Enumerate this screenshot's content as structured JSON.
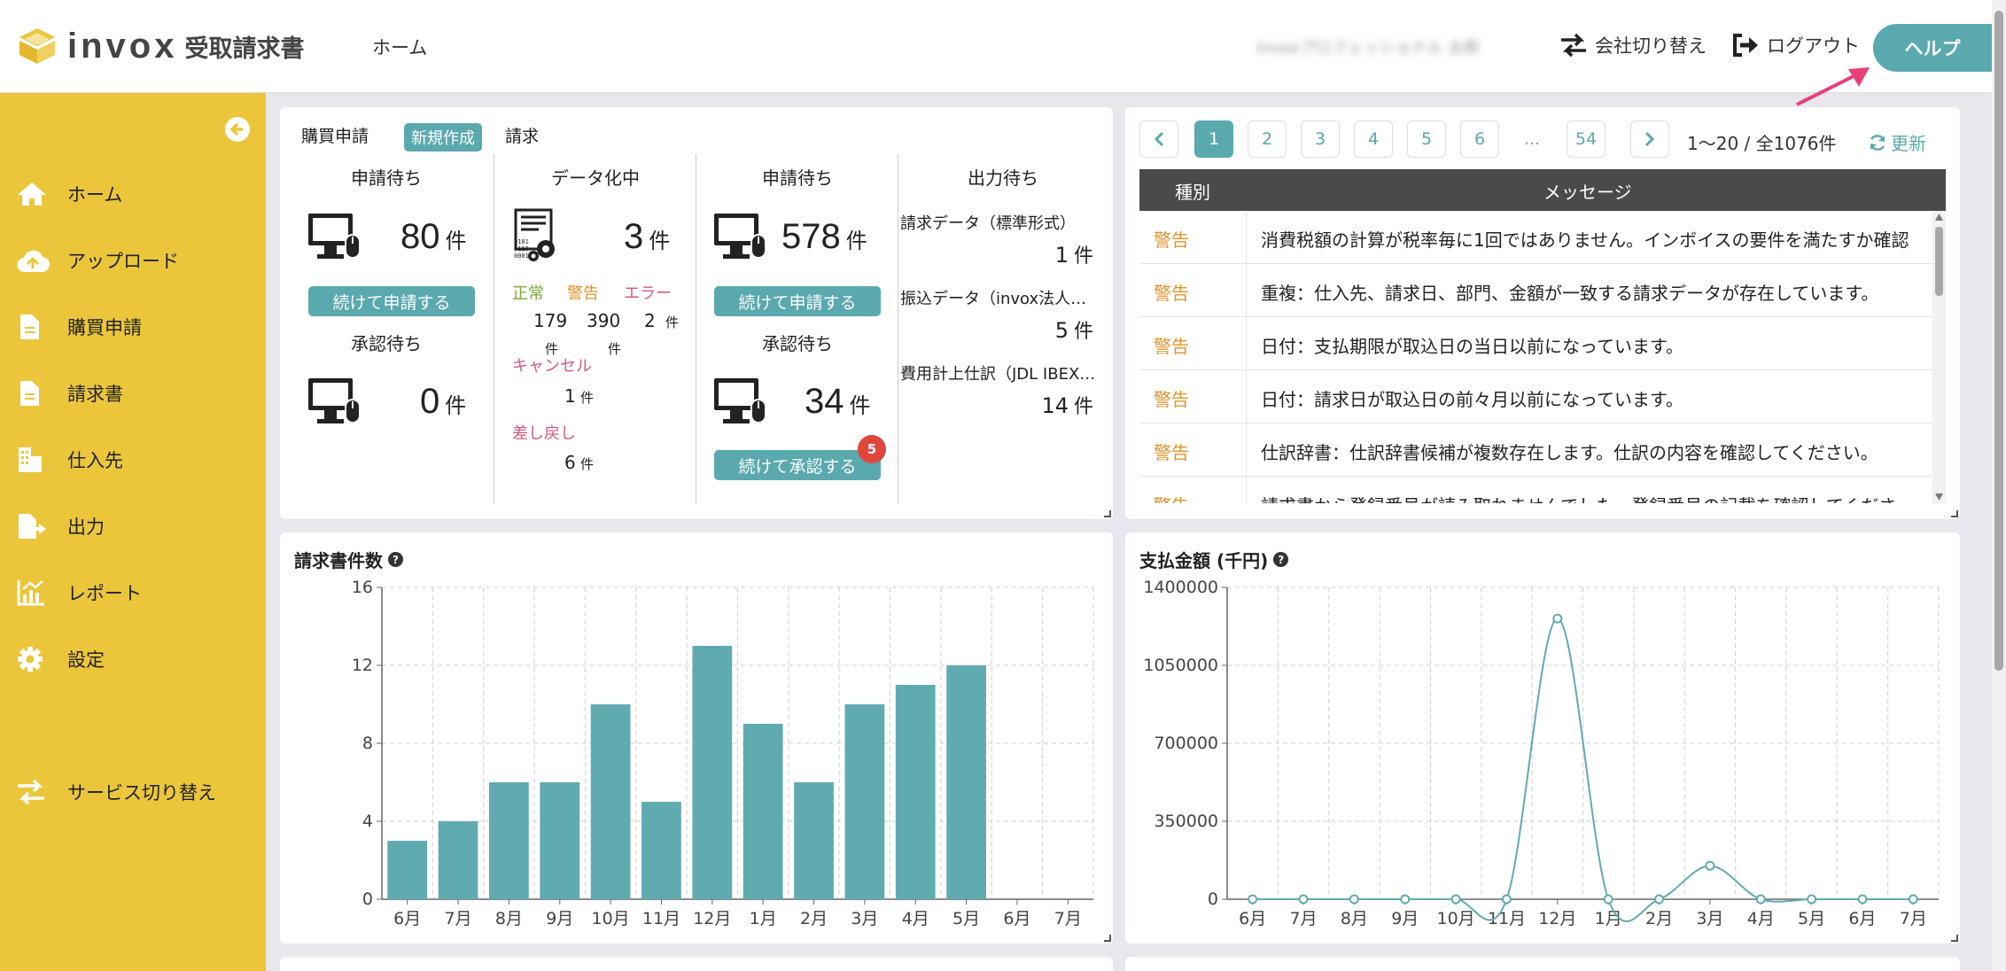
{
  "header": {
    "logo_word": "invox",
    "logo_sub": "受取請求書",
    "nav_home": "ホーム",
    "user_name": "invoxプロフェッショナル 太郎",
    "switch_company": "会社切り替え",
    "logout": "ログアウト",
    "help": "ヘルプ"
  },
  "sidebar": {
    "items": [
      {
        "label": "ホーム",
        "icon": "home-icon"
      },
      {
        "label": "アップロード",
        "icon": "cloud-upload-icon"
      },
      {
        "label": "購買申請",
        "icon": "document-icon"
      },
      {
        "label": "請求書",
        "icon": "document-icon"
      },
      {
        "label": "仕入先",
        "icon": "building-icon"
      },
      {
        "label": "出力",
        "icon": "file-export-icon"
      },
      {
        "label": "レポート",
        "icon": "chart-icon"
      },
      {
        "label": "設定",
        "icon": "gear-icon"
      }
    ],
    "service_switch": "サービス切り替え"
  },
  "summary": {
    "purchase_title": "購買申請",
    "new_button": "新規作成",
    "invoice_title": "請求",
    "purchase": {
      "pending_apply_label": "申請待ち",
      "pending_apply_count": "80",
      "continue_apply": "続けて申請する",
      "pending_approve_label": "承認待ち",
      "pending_approve_count": "0"
    },
    "digitizing": {
      "label": "データ化中",
      "count": "3",
      "normal_label": "正常",
      "warning_label": "警告",
      "error_label": "エラー",
      "normal_count": "179",
      "warning_count": "390",
      "error_count": "2",
      "cancel_label": "キャンセル",
      "cancel_count": "1",
      "returned_label": "差し戻し",
      "returned_count": "6"
    },
    "invoice": {
      "pending_apply_label": "申請待ち",
      "pending_apply_count": "578",
      "continue_apply": "続けて申請する",
      "pending_approve_label": "承認待ち",
      "pending_approve_count": "34",
      "continue_approve": "続けて承認する",
      "approve_badge": "5"
    },
    "output": {
      "label": "出力待ち",
      "items": [
        {
          "label": "請求データ（標準形式）",
          "count": "1"
        },
        {
          "label": "振込データ（invox法人…",
          "count": "5"
        },
        {
          "label": "費用計上仕訳（JDL IBEX…",
          "count": "14"
        }
      ]
    },
    "unit": "件"
  },
  "messages": {
    "pages": [
      "1",
      "2",
      "3",
      "4",
      "5",
      "6",
      "…",
      "54"
    ],
    "active_page": "1",
    "range_info": "1〜20 / 全1076件",
    "refresh": "更新",
    "col_kind": "種別",
    "col_message": "メッセージ",
    "rows": [
      {
        "kind": "警告",
        "message": "消費税額の計算が税率毎に1回ではありません。インボイスの要件を満たすか確認"
      },
      {
        "kind": "警告",
        "message": "重複：仕入先、請求日、部門、金額が一致する請求データが存在しています。"
      },
      {
        "kind": "警告",
        "message": "日付：支払期限が取込日の当日以前になっています。"
      },
      {
        "kind": "警告",
        "message": "日付：請求日が取込日の前々月以前になっています。"
      },
      {
        "kind": "警告",
        "message": "仕訳辞書：仕訳辞書候補が複数存在します。仕訳の内容を確認してください。"
      },
      {
        "kind": "警告",
        "message": "請求書から登録番号が読み取れませんでした。登録番号の記載を確認してくださ"
      }
    ]
  },
  "chart_data": [
    {
      "type": "bar",
      "title": "請求書件数",
      "categories": [
        "6月",
        "7月",
        "8月",
        "9月",
        "10月",
        "11月",
        "12月",
        "1月",
        "2月",
        "3月",
        "4月",
        "5月",
        "6月",
        "7月"
      ],
      "values": [
        3,
        4,
        6,
        6,
        10,
        5,
        13,
        9,
        6,
        10,
        11,
        12,
        0,
        0
      ],
      "ylim": [
        0,
        16
      ],
      "yticks": [
        "0",
        "4",
        "8",
        "12",
        "16"
      ],
      "grid": true,
      "color": "#5fabb0"
    },
    {
      "type": "line",
      "title": "支払金額 (千円)",
      "categories": [
        "6月",
        "7月",
        "8月",
        "9月",
        "10月",
        "11月",
        "12月",
        "1月",
        "2月",
        "3月",
        "4月",
        "5月",
        "6月",
        "7月"
      ],
      "values": [
        0,
        0,
        0,
        0,
        0,
        0,
        1260000,
        0,
        0,
        150000,
        0,
        0,
        0,
        0
      ],
      "ylim": [
        0,
        1400000
      ],
      "yticks": [
        "0",
        "350000",
        "700000",
        "1050000",
        "1400000"
      ],
      "grid": true,
      "color": "#5fabb0"
    }
  ]
}
